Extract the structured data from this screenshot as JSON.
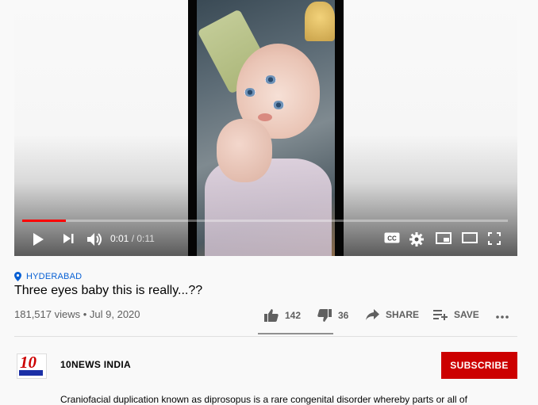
{
  "player": {
    "time_current": "0:01",
    "time_separator": " / ",
    "time_total": "0:11",
    "progress": 0.09,
    "cc_label": "CC",
    "accent_color": "#ff0000"
  },
  "video": {
    "location": "HYDERABAD",
    "title": "Three eyes baby this is really...??",
    "views": "181,517 views",
    "dot": " • ",
    "date": "Jul 9, 2020"
  },
  "actions": {
    "like_count": "142",
    "dislike_count": "36",
    "share_label": "SHARE",
    "save_label": "SAVE"
  },
  "channel": {
    "logo_text": "10",
    "name": "10NEWS INDIA",
    "subscribe_label": "SUBSCRIBE",
    "subscribe_color": "#cc0000"
  },
  "description": {
    "text": "Craniofacial duplication known as diprosopus is a rare congenital disorder whereby parts or all of"
  }
}
